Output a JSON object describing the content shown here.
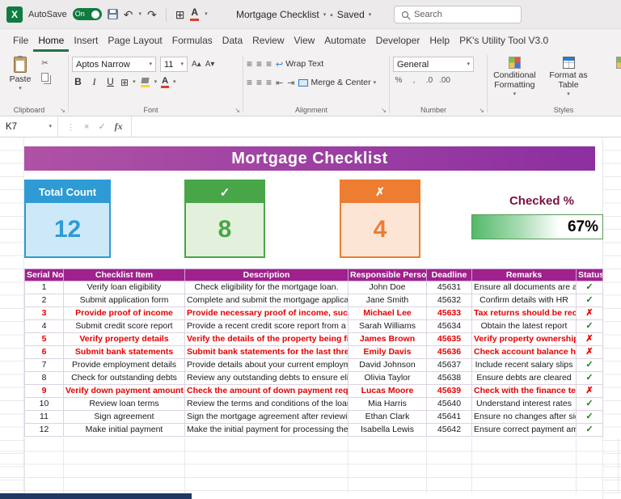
{
  "titlebar": {
    "autosave_label": "AutoSave",
    "autosave_state": "On",
    "doc_title": "Mortgage Checklist",
    "save_status": "Saved",
    "search_placeholder": "Search"
  },
  "menubar": {
    "tabs": [
      {
        "label": "File"
      },
      {
        "label": "Home",
        "active": true
      },
      {
        "label": "Insert"
      },
      {
        "label": "Page Layout"
      },
      {
        "label": "Formulas"
      },
      {
        "label": "Data"
      },
      {
        "label": "Review"
      },
      {
        "label": "View"
      },
      {
        "label": "Automate"
      },
      {
        "label": "Developer"
      },
      {
        "label": "Help"
      },
      {
        "label": "PK's Utility Tool V3.0"
      }
    ]
  },
  "ribbon": {
    "paste_label": "Paste",
    "clipboard_group": "Clipboard",
    "font_name": "Aptos Narrow",
    "font_size": "11",
    "bold_label": "B",
    "italic_label": "I",
    "underline_label": "U",
    "font_color_letter": "A",
    "font_group": "Font",
    "wrap_text_label": "Wrap Text",
    "merge_center_label": "Merge & Center",
    "alignment_group": "Alignment",
    "number_format": "General",
    "number_icons": [
      "%",
      ",",
      ".0",
      ".00"
    ],
    "number_group": "Number",
    "conditional_formatting_label": "Conditional Formatting",
    "format_as_table_label": "Format as Table",
    "styles_group": "Styles"
  },
  "formula_bar": {
    "cell_reference": "K7",
    "fx_label": "fx"
  },
  "icons": {
    "excel_logo": "X",
    "undo": "↶",
    "redo": "↷",
    "table_grid": "⊞",
    "cut": "✂",
    "borders": "⊞",
    "grow_font": "A▴",
    "shrink_font": "A▾",
    "cancel": "×",
    "enter": "✓"
  },
  "sheet": {
    "banner_title": "Mortgage Checklist",
    "cards": {
      "total": {
        "label": "Total Count",
        "value": "12"
      },
      "checked": {
        "icon": "✓",
        "value": "8"
      },
      "unchecked": {
        "icon": "✗",
        "value": "4"
      },
      "percent": {
        "label": "Checked %",
        "value": "67%",
        "fill": 67
      }
    },
    "table": {
      "headers": [
        "Serial No.",
        "Checklist Item",
        "Description",
        "Responsible Person",
        "Deadline",
        "Remarks",
        "Status"
      ],
      "rows": [
        {
          "serial": "1",
          "item": "Verify loan eligibility",
          "description": "Check eligibility for the mortgage loan.",
          "person": "John Doe",
          "deadline": "45631",
          "remarks": "Ensure all documents are accurate",
          "status": "✓",
          "flagged": false
        },
        {
          "serial": "2",
          "item": "Submit application form",
          "description": "Complete and submit the mortgage application form.",
          "person": "Jane Smith",
          "deadline": "45632",
          "remarks": "Confirm details with HR",
          "status": "✓",
          "flagged": false
        },
        {
          "serial": "3",
          "item": "Provide proof of income",
          "description": "Provide necessary proof of income, such as pay stubs or tax returns.",
          "person": "Michael Lee",
          "deadline": "45633",
          "remarks": "Tax returns should be recent",
          "status": "✗",
          "flagged": true
        },
        {
          "serial": "4",
          "item": "Submit credit score report",
          "description": "Provide a recent credit score report from a recognized agency.",
          "person": "Sarah Williams",
          "deadline": "45634",
          "remarks": "Obtain the latest report",
          "status": "✓",
          "flagged": false
        },
        {
          "serial": "5",
          "item": "Verify property details",
          "description": "Verify the details of the property being financed.",
          "person": "James Brown",
          "deadline": "45635",
          "remarks": "Verify property ownership",
          "status": "✗",
          "flagged": true
        },
        {
          "serial": "6",
          "item": "Submit bank statements",
          "description": "Submit bank statements for the last three months.",
          "person": "Emily Davis",
          "deadline": "45636",
          "remarks": "Check account balance history",
          "status": "✗",
          "flagged": true
        },
        {
          "serial": "7",
          "item": "Provide employment details",
          "description": "Provide details about your current employment status.",
          "person": "David Johnson",
          "deadline": "45637",
          "remarks": "Include recent salary slips",
          "status": "✓",
          "flagged": false
        },
        {
          "serial": "8",
          "item": "Check for outstanding debts",
          "description": "Review any outstanding debts to ensure eligibility.",
          "person": "Olivia Taylor",
          "deadline": "45638",
          "remarks": "Ensure debts are cleared",
          "status": "✓",
          "flagged": false
        },
        {
          "serial": "9",
          "item": "Verify down payment amount",
          "description": "Check the amount of down payment required for the loan.",
          "person": "Lucas Moore",
          "deadline": "45639",
          "remarks": "Check with the finance team",
          "status": "✗",
          "flagged": true
        },
        {
          "serial": "10",
          "item": "Review loan terms",
          "description": "Review the terms and conditions of the loan agreement.",
          "person": "Mia Harris",
          "deadline": "45640",
          "remarks": "Understand interest rates",
          "status": "✓",
          "flagged": false
        },
        {
          "serial": "11",
          "item": "Sign agreement",
          "description": "Sign the mortgage agreement after reviewing the terms.",
          "person": "Ethan Clark",
          "deadline": "45641",
          "remarks": "Ensure no changes after signing",
          "status": "✓",
          "flagged": false
        },
        {
          "serial": "12",
          "item": "Make initial payment",
          "description": "Make the initial payment for processing the loan.",
          "person": "Isabella Lewis",
          "deadline": "45642",
          "remarks": "Ensure correct payment amount",
          "status": "✓",
          "flagged": false
        }
      ]
    }
  },
  "colors": {
    "excel_green": "#107C41",
    "toggle_green": "#0F7B3E",
    "home_underline": "#217346",
    "banner_purple_1": "#AF52A5",
    "banner_purple_2": "#8C2FA0",
    "table_header": "#A0218C",
    "blue": "#2E9BD5",
    "blue_light": "#CDE9F8",
    "green": "#48A648",
    "green_light": "#E3F0DB",
    "orange": "#ED7D31",
    "orange_light": "#FCE5D5",
    "maroon": "#7C1042",
    "progress_green": "#53B96A",
    "flag_red": "#E60000",
    "check_green": "#1E7A1E",
    "bottom_bar_navy": "#1F3864"
  }
}
